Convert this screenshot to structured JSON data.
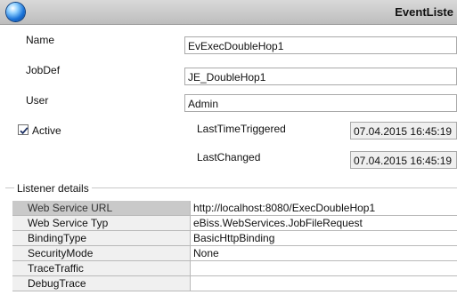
{
  "window": {
    "title": "EventListe"
  },
  "form": {
    "name_label": "Name",
    "name_value": "EvExecDoubleHop1",
    "jobdef_label": "JobDef",
    "jobdef_value": "JE_DoubleHop1",
    "user_label": "User",
    "user_value": "Admin",
    "active_label": "Active",
    "active_checked": true,
    "last_triggered_label": "LastTimeTriggered",
    "last_triggered_value": "07.04.2015 16:45:19",
    "last_changed_label": "LastChanged",
    "last_changed_value": "07.04.2015 16:45:19"
  },
  "listener": {
    "group_label": "Listener details",
    "rows": [
      {
        "name": "Web Service URL",
        "value": "http://localhost:8080/ExecDoubleHop1"
      },
      {
        "name": "Web Service Typ",
        "value": "eBiss.WebServices.JobFileRequest"
      },
      {
        "name": "BindingType",
        "value": "BasicHttpBinding"
      },
      {
        "name": "SecurityMode",
        "value": "None"
      },
      {
        "name": "TraceTraffic",
        "value": ""
      },
      {
        "name": "DebugTrace",
        "value": ""
      }
    ],
    "selected_row": "Web Service URL"
  },
  "icons": {
    "app_icon": "app-orb-icon",
    "check_icon": "checkmark-icon"
  },
  "colors": {
    "orb_blue": "#1a73d9",
    "selected_row_bg": "#c9c9c9",
    "label_column_bg": "#f0f0f0"
  }
}
